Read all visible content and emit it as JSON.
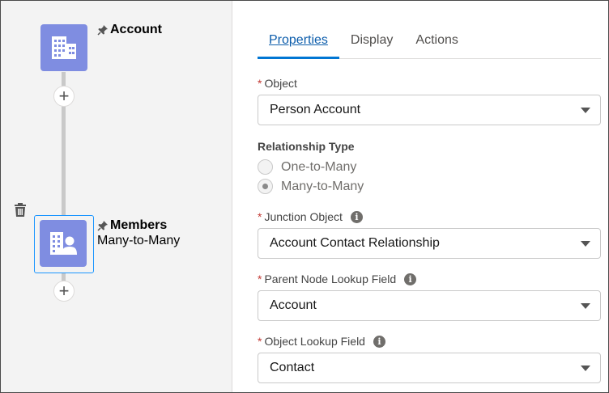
{
  "canvas": {
    "nodes": [
      {
        "title": "Account",
        "subtitle": "",
        "icon": "building-icon"
      },
      {
        "title": "Members",
        "subtitle": "Many-to-Many",
        "icon": "contact-building-icon"
      }
    ],
    "add_symbol": "+"
  },
  "tabs": [
    {
      "label": "Properties",
      "active": true
    },
    {
      "label": "Display",
      "active": false
    },
    {
      "label": "Actions",
      "active": false
    }
  ],
  "form": {
    "required_mark": "*",
    "object": {
      "label": "Object",
      "value": "Person Account"
    },
    "relationship_type": {
      "label": "Relationship Type",
      "options": [
        {
          "label": "One-to-Many",
          "selected": false
        },
        {
          "label": "Many-to-Many",
          "selected": true
        }
      ]
    },
    "junction_object": {
      "label": "Junction Object",
      "value": "Account Contact Relationship"
    },
    "parent_lookup": {
      "label": "Parent Node Lookup Field",
      "value": "Account"
    },
    "object_lookup": {
      "label": "Object Lookup Field",
      "value": "Contact"
    },
    "info_glyph": "i"
  },
  "colors": {
    "node_tile": "#7f8de1",
    "active_tab": "#0176d3",
    "required": "#c23934"
  }
}
